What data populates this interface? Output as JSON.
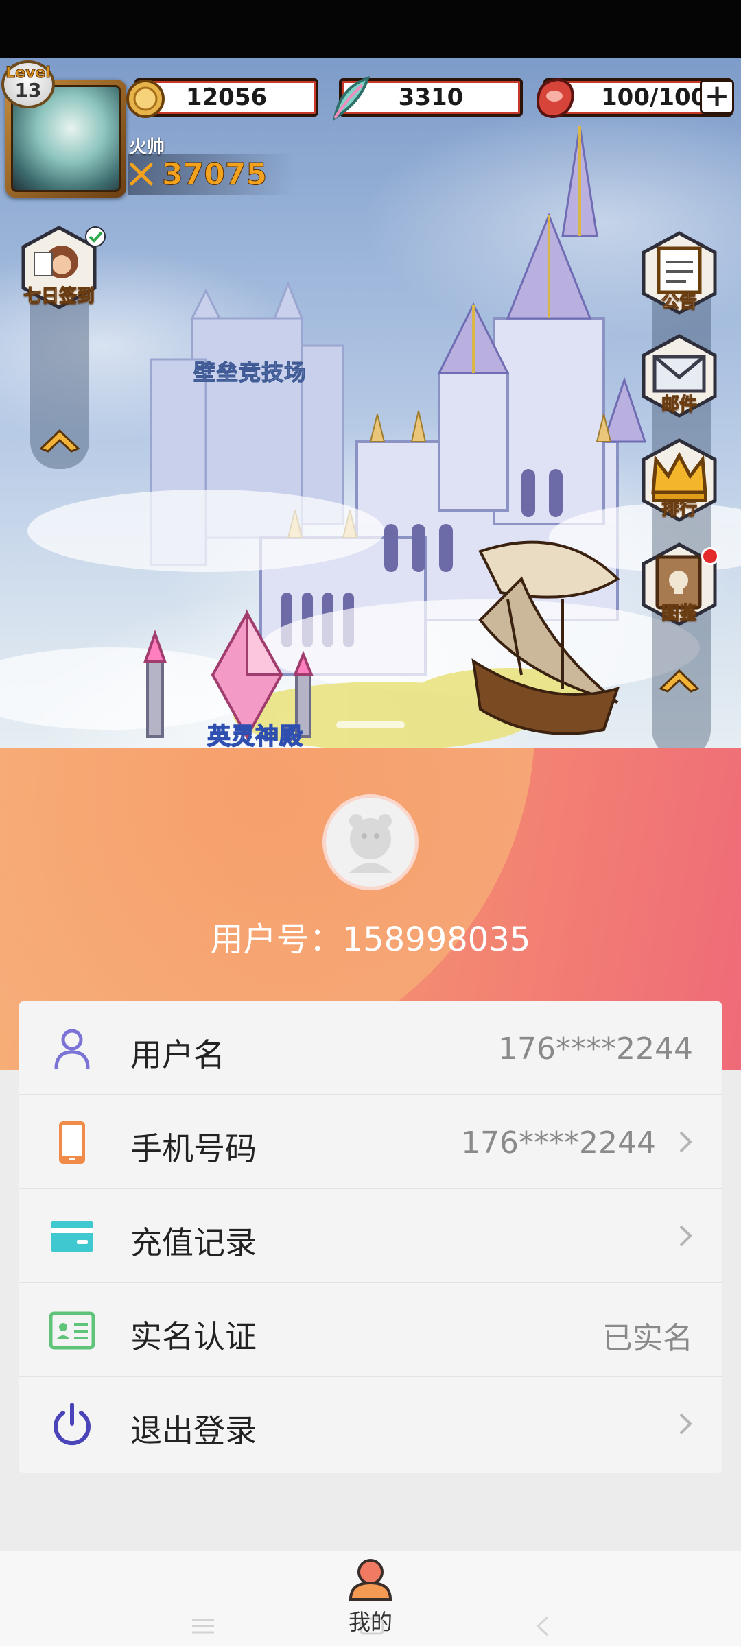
{
  "player": {
    "level_label": "Level",
    "level": "13",
    "name": "火帅",
    "power": "37075"
  },
  "resources": [
    {
      "name": "gold",
      "value": "12056"
    },
    {
      "name": "feather",
      "value": "3310"
    },
    {
      "name": "stamina",
      "value": "100/100"
    }
  ],
  "left_buttons": [
    {
      "label": "七日签到"
    }
  ],
  "right_buttons": [
    {
      "label": "公告"
    },
    {
      "label": "邮件"
    },
    {
      "label": "排行"
    },
    {
      "label": "图鉴"
    }
  ],
  "map_labels": {
    "arena": "壁垒竞技场",
    "temple": "英灵神殿"
  },
  "profile": {
    "user_id": "用户号：158998035"
  },
  "menu": [
    {
      "label": "用户名",
      "value": "176****2244",
      "icon": "user-icon",
      "arrow": false
    },
    {
      "label": "手机号码",
      "value": "176****2244",
      "icon": "phone-icon",
      "arrow": true
    },
    {
      "label": "充值记录",
      "value": "",
      "icon": "card-icon",
      "arrow": true
    },
    {
      "label": "实名认证",
      "value": "已实名",
      "icon": "id-card-icon",
      "arrow": false
    },
    {
      "label": "退出登录",
      "value": "",
      "icon": "power-icon",
      "arrow": true
    }
  ],
  "tabbar": {
    "me_label": "我的"
  },
  "colors": {
    "header_gradient_start": "#f7b277",
    "header_gradient_end": "#ef6a78",
    "power_text": "#f3a21d"
  }
}
